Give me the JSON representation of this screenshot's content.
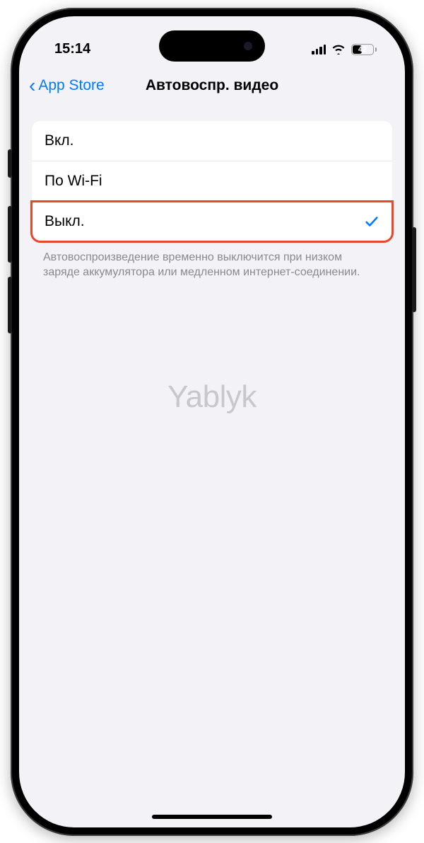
{
  "status": {
    "time": "15:14",
    "battery_level": "42"
  },
  "nav": {
    "back_label": "App Store",
    "title": "Автовоспр. видео"
  },
  "options": [
    {
      "label": "Вкл.",
      "selected": false,
      "highlighted": false
    },
    {
      "label": "По Wi-Fi",
      "selected": false,
      "highlighted": false
    },
    {
      "label": "Выкл.",
      "selected": true,
      "highlighted": true
    }
  ],
  "footer": "Автовоспроизведение временно выключится при низком заряде аккумулятора или медленном интернет-соединении.",
  "watermark": "Yablyk"
}
